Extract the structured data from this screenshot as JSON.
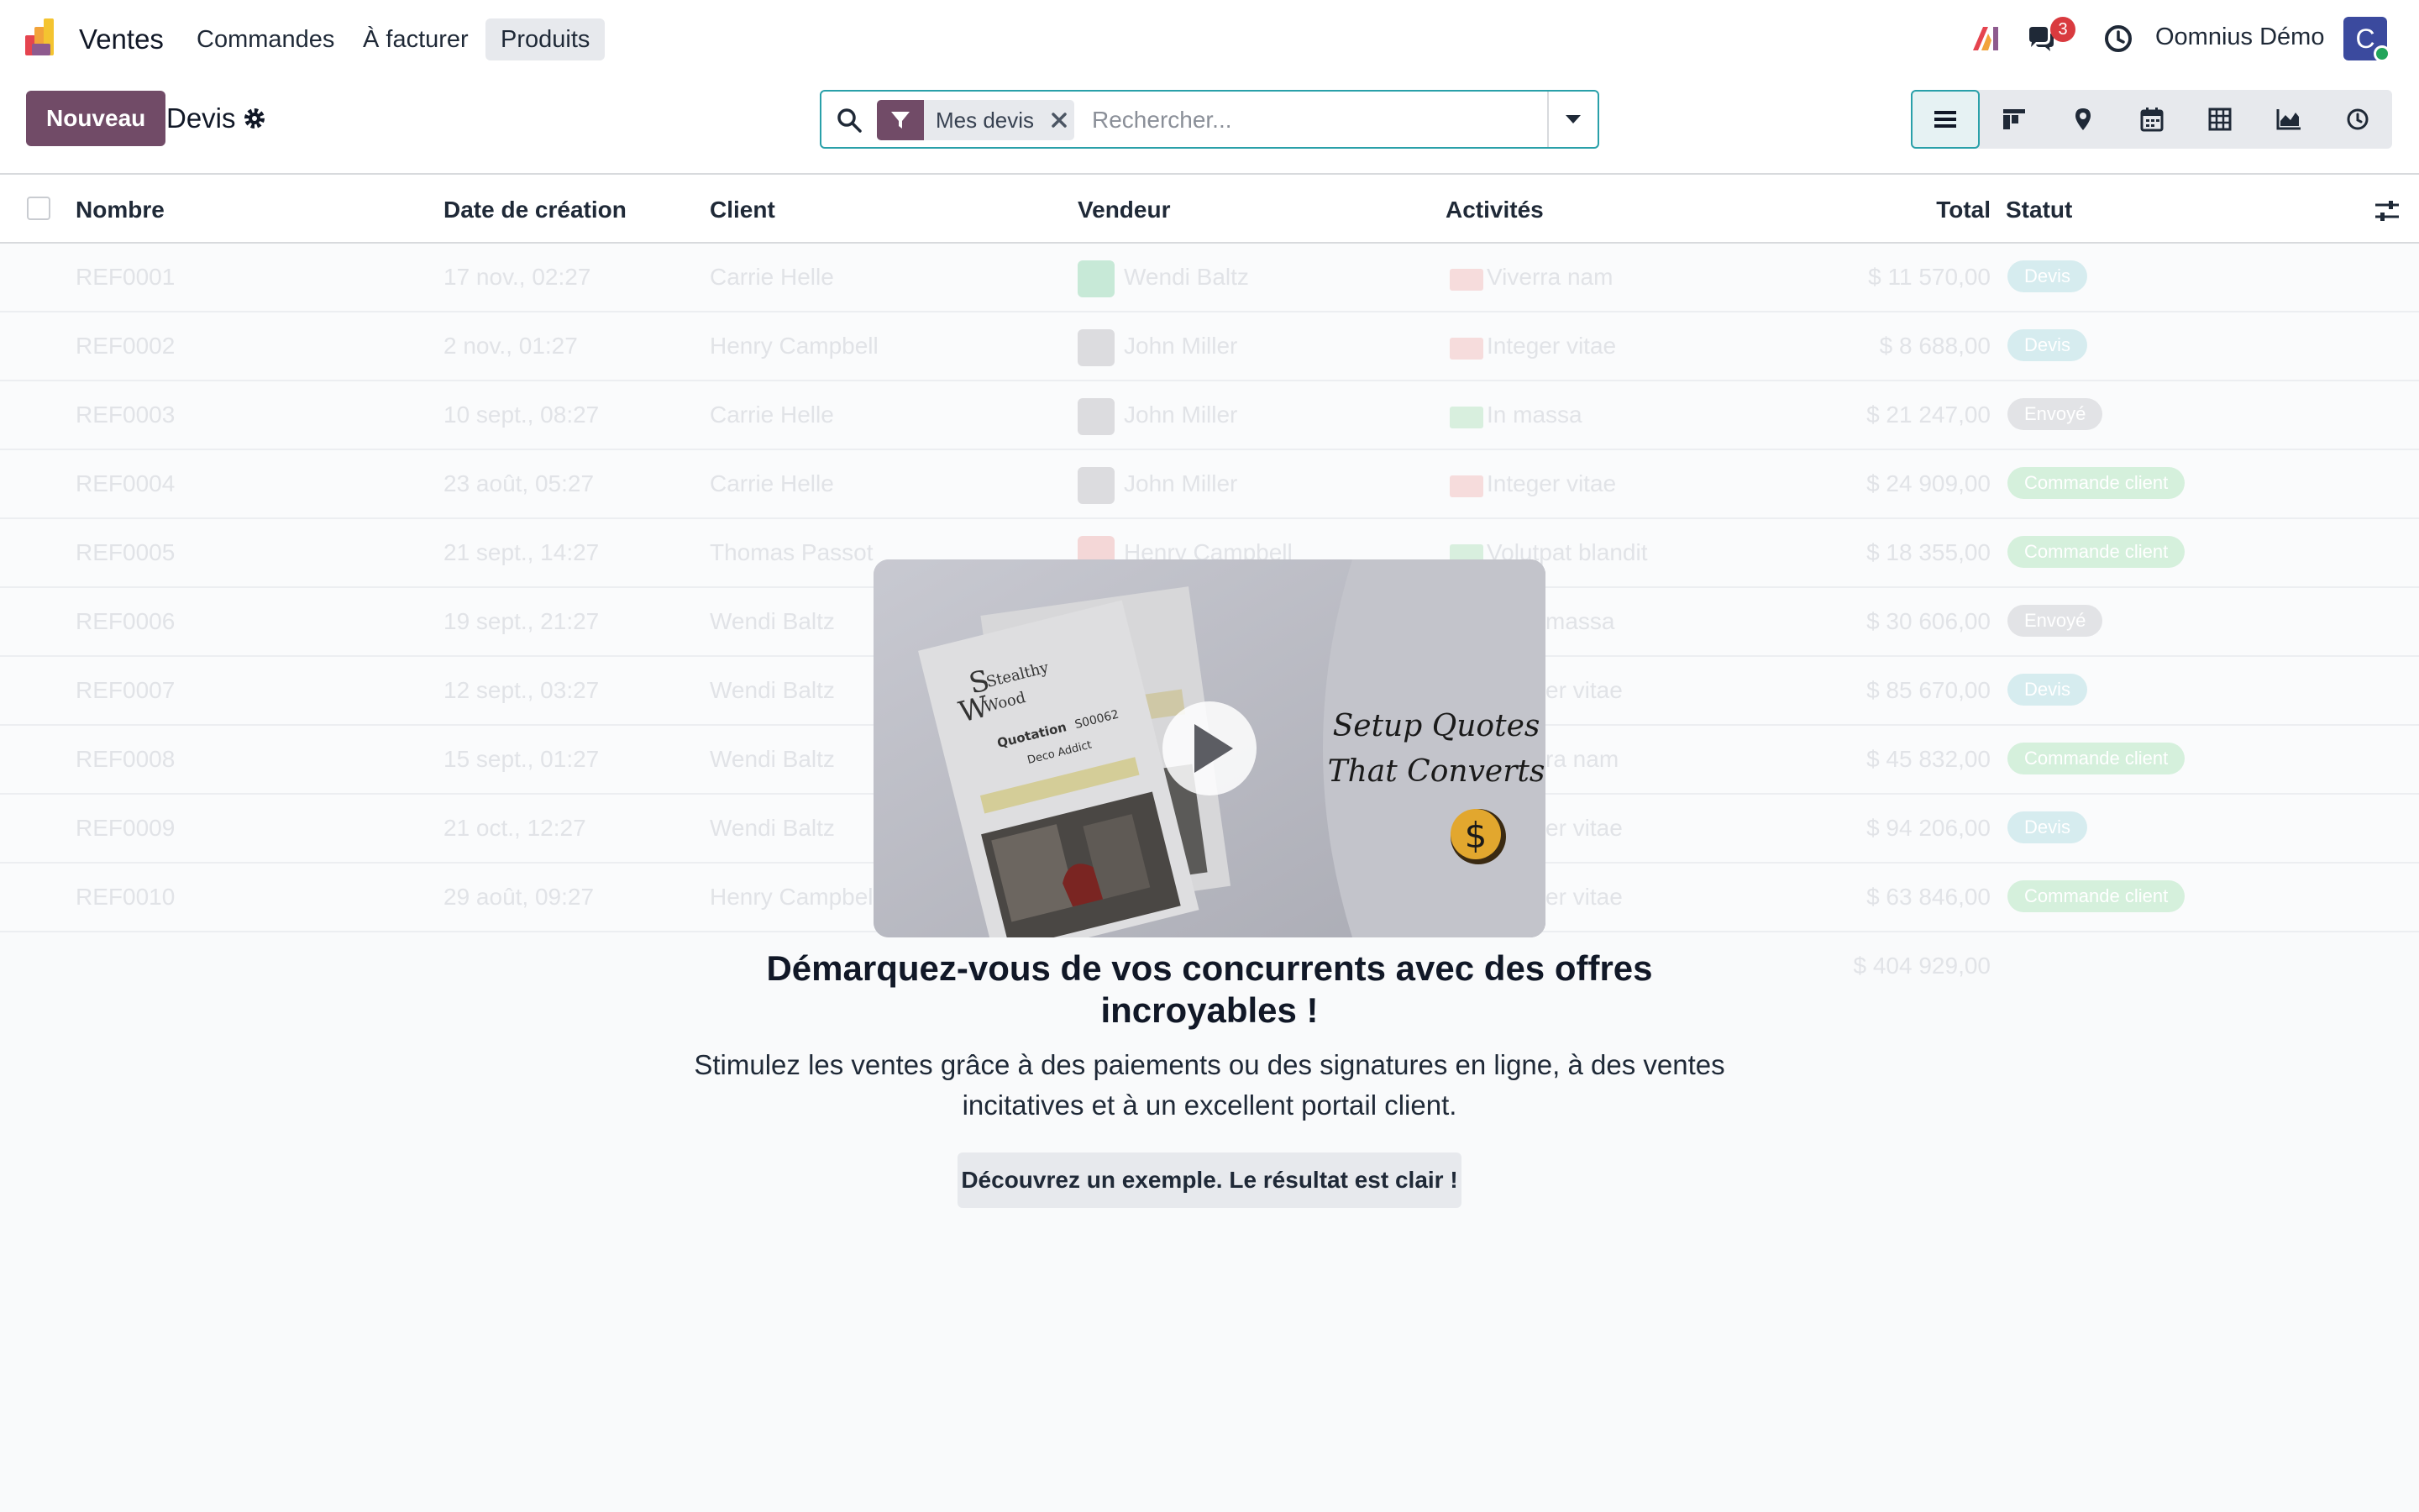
{
  "nav": {
    "app_name": "Ventes",
    "menu": [
      "Commandes",
      "À facturer",
      "Produits"
    ],
    "active_menu": "Produits",
    "messages_badge": "3",
    "user_name": "Oomnius Démo",
    "avatar_letter": "C",
    "colors": {
      "brand": "#714b67",
      "accent": "#29a0a9",
      "badge": "#d93a3f"
    }
  },
  "control": {
    "new_button": "Nouveau",
    "breadcrumb": "Devis",
    "search": {
      "facet_label": "Mes devis",
      "placeholder": "Rechercher..."
    },
    "views": [
      "list-view-icon",
      "kanban-view-icon",
      "map-view-icon",
      "calendar-view-icon",
      "pivot-view-icon",
      "graph-view-icon",
      "activity-view-icon"
    ]
  },
  "list": {
    "columns": {
      "number": "Nombre",
      "date": "Date de création",
      "client": "Client",
      "salesperson": "Vendeur",
      "activities": "Activités",
      "total": "Total",
      "status": "Statut"
    },
    "rows": [
      {
        "ref": "REF0001",
        "date": "17 nov., 02:27",
        "client": "Carrie Helle",
        "salesperson": "Wendi Baltz",
        "activity": "Viverra nam",
        "total": "$ 11 570,00",
        "status": "Devis"
      },
      {
        "ref": "REF0002",
        "date": "2 nov., 01:27",
        "client": "Henry Campbell",
        "salesperson": "John Miller",
        "activity": "Integer vitae",
        "total": "$ 8 688,00",
        "status": "Devis"
      },
      {
        "ref": "REF0003",
        "date": "10 sept., 08:27",
        "client": "Carrie Helle",
        "salesperson": "John Miller",
        "activity": "In massa",
        "total": "$ 21 247,00",
        "status": "Envoyé"
      },
      {
        "ref": "REF0004",
        "date": "23 août, 05:27",
        "client": "Carrie Helle",
        "salesperson": "John Miller",
        "activity": "Integer vitae",
        "total": "$ 24 909,00",
        "status": "Commande client"
      },
      {
        "ref": "REF0005",
        "date": "21 sept., 14:27",
        "client": "Thomas Passot",
        "salesperson": "Henry Campbell",
        "activity": "Volutpat blandit",
        "total": "$ 18 355,00",
        "status": "Commande client"
      },
      {
        "ref": "REF0006",
        "date": "19 sept., 21:27",
        "client": "Wendi Baltz",
        "salesperson": "",
        "activity": "massa",
        "total": "$ 30 606,00",
        "status": "Envoyé"
      },
      {
        "ref": "REF0007",
        "date": "12 sept., 03:27",
        "client": "Wendi Baltz",
        "salesperson": "",
        "activity": "er vitae",
        "total": "$ 85 670,00",
        "status": "Devis"
      },
      {
        "ref": "REF0008",
        "date": "15 sept., 01:27",
        "client": "Wendi Baltz",
        "salesperson": "",
        "activity": "ra nam",
        "total": "$ 45 832,00",
        "status": "Commande client"
      },
      {
        "ref": "REF0009",
        "date": "21 oct., 12:27",
        "client": "Wendi Baltz",
        "salesperson": "",
        "activity": "er vitae",
        "total": "$ 94 206,00",
        "status": "Devis"
      },
      {
        "ref": "REF0010",
        "date": "29 août, 09:27",
        "client": "Henry Campbell",
        "salesperson": "",
        "activity": "er vitae",
        "total": "$ 63 846,00",
        "status": "Commande client"
      }
    ],
    "sum_total": "$ 404 929,00"
  },
  "helper": {
    "video": {
      "brand_line1": "Stealthy",
      "brand_line2": "Wood",
      "doc_title": "Quotation",
      "doc_number": "S00062",
      "doc_client": "Deco Addict",
      "slogan_line1": "Setup Quotes",
      "slogan_line2": "That Converts"
    },
    "title": "Démarquez-vous de vos concurrents avec des offres incroyables !",
    "text": "Stimulez les ventes grâce à des paiements ou des signatures en ligne, à des ventes incitatives et à un excellent portail client.",
    "button": "Découvrez un exemple. Le résultat est clair !"
  }
}
